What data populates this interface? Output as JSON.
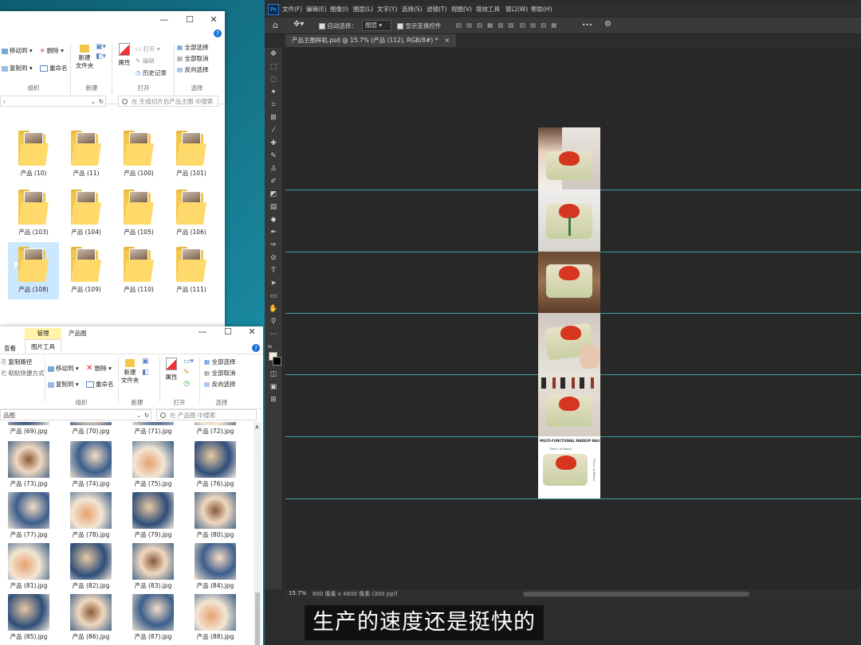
{
  "explorer_top": {
    "ribbon": {
      "move_to": "移动到",
      "delete": "删除",
      "copy_to": "复制到",
      "rename": "重命名",
      "new_folder": "新建\n文件夹",
      "properties": "属性",
      "open": "打开",
      "edit": "编辑",
      "history": "历史记录",
      "select_all": "全部选择",
      "select_none": "全部取消",
      "invert_selection": "反向选择",
      "group_organize": "组织",
      "group_new": "新建",
      "group_open": "打开",
      "group_select": "选择"
    },
    "address": "›",
    "search_placeholder": "在 生成切片后产品主图 中搜索",
    "folders": [
      {
        "label": "产品 (10)"
      },
      {
        "label": "产品 (11)"
      },
      {
        "label": "产品 (100)"
      },
      {
        "label": "产品 (101)"
      },
      {
        "label": "产品 (103)"
      },
      {
        "label": "产品 (104)"
      },
      {
        "label": "产品 (105)"
      },
      {
        "label": "产品 (106)"
      },
      {
        "label": "产品 (108)"
      },
      {
        "label": "产品 (109)"
      },
      {
        "label": "产品 (110)"
      },
      {
        "label": "产品 (111)"
      }
    ]
  },
  "explorer_bottom": {
    "context_tab": "管理",
    "window_title": "产品图",
    "tab_view": "查看",
    "tab_picture_tools": "图片工具",
    "ribbon": {
      "copy_path": "复制路径",
      "paste_shortcut": "粘贴快捷方式",
      "move_to": "移动到",
      "delete": "删除",
      "copy_to": "复制到",
      "rename": "重命名",
      "new_folder": "新建\n文件夹",
      "properties": "属性",
      "select_all": "全部选择",
      "select_none": "全部取消",
      "invert_selection": "反向选择",
      "group_organize": "组织",
      "group_new": "新建",
      "group_open": "打开",
      "group_select": "选择"
    },
    "address": "品图",
    "search_placeholder": "在 产品图 中搜索",
    "images": [
      {
        "label": "产品 (69).jpg"
      },
      {
        "label": "产品 (70).jpg"
      },
      {
        "label": "产品 (71).jpg"
      },
      {
        "label": "产品 (72).jpg"
      },
      {
        "label": "产品 (73).jpg"
      },
      {
        "label": "产品 (74).jpg"
      },
      {
        "label": "产品 (75).jpg"
      },
      {
        "label": "产品 (76).jpg"
      },
      {
        "label": "产品 (77).jpg"
      },
      {
        "label": "产品 (78).jpg"
      },
      {
        "label": "产品 (79).jpg"
      },
      {
        "label": "产品 (80).jpg"
      },
      {
        "label": "产品 (81).jpg"
      },
      {
        "label": "产品 (82).jpg"
      },
      {
        "label": "产品 (83).jpg"
      },
      {
        "label": "产品 (84).jpg"
      },
      {
        "label": "产品 (85).jpg"
      },
      {
        "label": "产品 (86).jpg"
      },
      {
        "label": "产品 (87).jpg"
      },
      {
        "label": "产品 (88).jpg"
      }
    ]
  },
  "photoshop": {
    "logo": "Ps",
    "menu": [
      "文件(F)",
      "编辑(E)",
      "图像(I)",
      "图层(L)",
      "文字(Y)",
      "选择(S)",
      "滤镜(T)",
      "视图(V)",
      "增效工具",
      "窗口(W)",
      "帮助(H)"
    ],
    "options": {
      "auto_select": "自动选择：",
      "layer_mode": "图层",
      "show_transform": "显示变换控件",
      "more": "•••"
    },
    "doc_tab": "产品主图样机.psd @ 15.7% (产品 (112), RGB/8#) *",
    "canvas_banner": "MULTI-FUNCTIONAL MAKEUP BAG",
    "size_label": "23cm / 9.05inch",
    "size_label_vertical": "17cm / 6.69inch",
    "status_zoom": "15.7%",
    "status_info": "800 像素 x 4800 像素 (300 ppi)",
    "status_arrow": "›"
  },
  "subtitle": "生产的速度还是挺快的",
  "colors": {
    "guide": "#3d9fa0",
    "ps_bg": "#2c2c2c",
    "flower_red": "#d6361f",
    "folder_yellow": "#f2c84b"
  }
}
